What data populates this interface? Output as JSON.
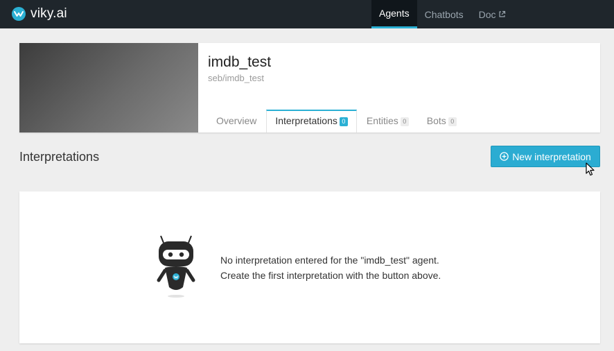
{
  "app": {
    "brand": "viky.ai"
  },
  "nav": {
    "items": [
      {
        "label": "Agents",
        "active": true
      },
      {
        "label": "Chatbots",
        "active": false
      },
      {
        "label": "Doc",
        "active": false,
        "icon": "external-link-icon"
      }
    ]
  },
  "agent": {
    "title": "imdb_test",
    "slug": "seb/imdb_test"
  },
  "tabs": [
    {
      "label": "Overview",
      "count": null,
      "active": false
    },
    {
      "label": "Interpretations",
      "count": "0",
      "active": true
    },
    {
      "label": "Entities",
      "count": "0",
      "active": false
    },
    {
      "label": "Bots",
      "count": "0",
      "active": false
    }
  ],
  "section": {
    "title": "Interpretations",
    "new_button": "New interpretation"
  },
  "empty_state": {
    "line1": "No interpretation entered for the \"imdb_test\" agent.",
    "line2": "Create the first interpretation with the button above."
  },
  "colors": {
    "accent": "#2bb0d4",
    "topbar": "#1f262c",
    "background": "#eeeeee"
  }
}
